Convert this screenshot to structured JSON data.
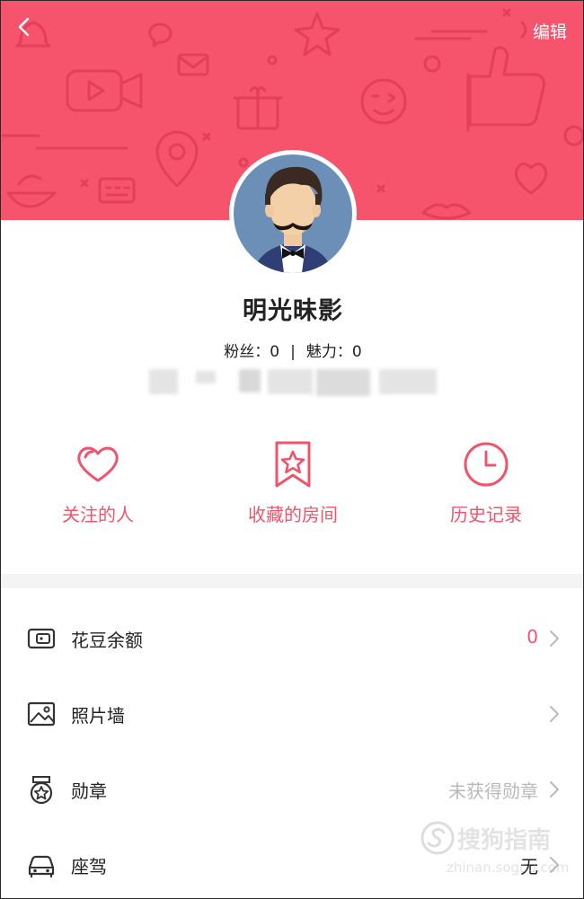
{
  "header": {
    "edit_label": "编辑",
    "bg_color": "#f5546c"
  },
  "profile": {
    "username": "明光昧影",
    "fans_label": "粉丝",
    "fans_value": "0",
    "charm_label": "魅力",
    "charm_value": "0"
  },
  "quick_actions": [
    {
      "label": "关注的人",
      "icon": "heart-icon"
    },
    {
      "label": "收藏的房间",
      "icon": "bookmark-star-icon"
    },
    {
      "label": "历史记录",
      "icon": "clock-icon"
    }
  ],
  "menu": [
    {
      "label": "花豆余额",
      "value": "0",
      "icon": "wallet-icon"
    },
    {
      "label": "照片墙",
      "value": "",
      "icon": "image-icon"
    },
    {
      "label": "勋章",
      "value": "未获得勋章",
      "icon": "medal-icon"
    },
    {
      "label": "座驾",
      "value": "无",
      "icon": "car-icon"
    }
  ],
  "watermark": {
    "text": "搜狗指南",
    "sub": "zhinan.sogou.com"
  },
  "colors": {
    "accent": "#f0546c",
    "muted": "#b9b9b9"
  }
}
